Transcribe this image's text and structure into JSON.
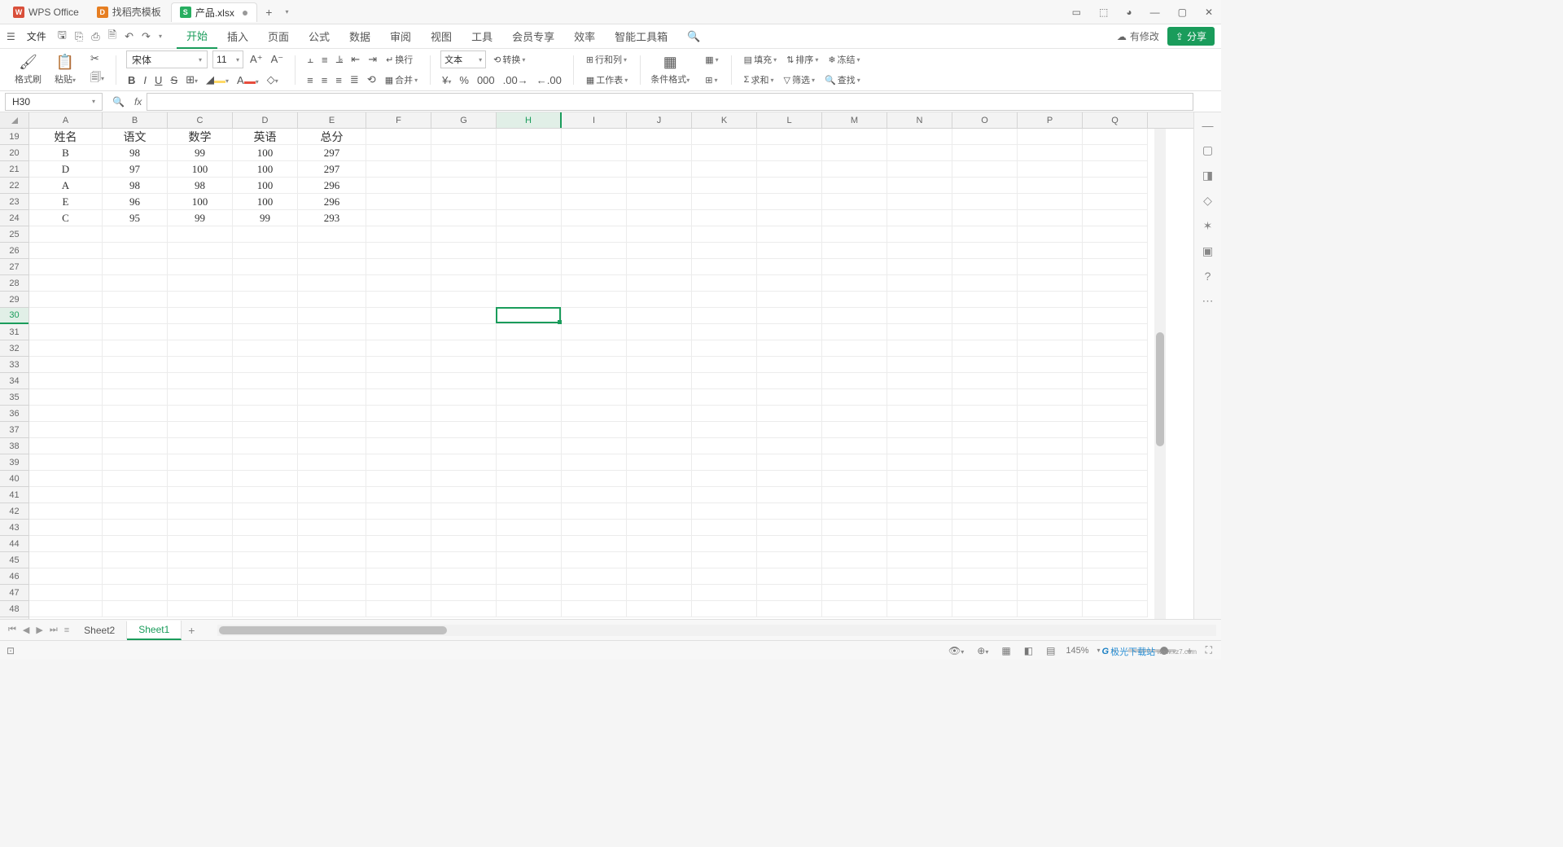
{
  "titlebar": {
    "app_name": "WPS Office",
    "template_tab": "找稻壳模板",
    "doc_tab": "产品.xlsx",
    "modified_dot": "●",
    "plus": "+"
  },
  "win": {
    "min": "—",
    "max": "▢",
    "close": "✕"
  },
  "menubar": {
    "file": "文件",
    "tabs": [
      "开始",
      "插入",
      "页面",
      "公式",
      "数据",
      "审阅",
      "视图",
      "工具",
      "会员专享",
      "效率",
      "智能工具箱"
    ],
    "cloud": "有修改",
    "share": "分享"
  },
  "ribbon": {
    "fmt_brush": "格式刷",
    "paste": "粘贴",
    "font_name": "宋体",
    "font_size": "11",
    "wrap": "换行",
    "merge": "合并",
    "num_fmt": "文本",
    "convert": "转换",
    "row_col": "行和列",
    "worksheet": "工作表",
    "cond_fmt": "条件格式",
    "fill": "填充",
    "sort": "排序",
    "freeze": "冻结",
    "sum": "求和",
    "filter": "筛选",
    "find": "查找"
  },
  "namebox": "H30",
  "columns": [
    "A",
    "B",
    "C",
    "D",
    "E",
    "F",
    "G",
    "H",
    "I",
    "J",
    "K",
    "L",
    "M",
    "N",
    "O",
    "P",
    "Q"
  ],
  "row_start": 19,
  "row_end": 48,
  "selected": {
    "col": "H",
    "col_index": 7,
    "row": 30
  },
  "table": {
    "header_row": 19,
    "headers": [
      "姓名",
      "语文",
      "数学",
      "英语",
      "总分"
    ],
    "rows": [
      [
        "B",
        "98",
        "99",
        "100",
        "297"
      ],
      [
        "D",
        "97",
        "100",
        "100",
        "297"
      ],
      [
        "A",
        "98",
        "98",
        "100",
        "296"
      ],
      [
        "E",
        "96",
        "100",
        "100",
        "296"
      ],
      [
        "C",
        "95",
        "99",
        "99",
        "293"
      ]
    ]
  },
  "sheet_tabs": {
    "list": [
      "Sheet2",
      "Sheet1"
    ],
    "active": 1,
    "add": "+"
  },
  "status": {
    "zoom": "145%",
    "watermark": "极光下载站",
    "watermark2": "www.xz7.com"
  }
}
